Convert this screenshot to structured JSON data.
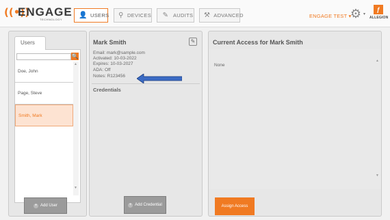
{
  "header": {
    "logo_word": "ENGAGE",
    "logo_sub": "TECHNOLOGY",
    "logo_mark": "((•))",
    "tabs": [
      {
        "label": "USERS",
        "icon": "user-icon",
        "glyph": "👤"
      },
      {
        "label": "DEVICES",
        "icon": "device-icon",
        "glyph": "⚲"
      },
      {
        "label": "AUDITS",
        "icon": "audit-icon",
        "glyph": "✎"
      },
      {
        "label": "ADVANCED",
        "icon": "tools-icon",
        "glyph": "⚒"
      }
    ],
    "org_name": "ENGAGE TEST ▾",
    "gear_glyph": "⚙",
    "gear_caret": "▾",
    "brand": "ALLEGION",
    "brand_mark": "ƒ"
  },
  "users_panel": {
    "tab_label": "Users",
    "search_value": "",
    "search_icon_glyph": "🔍",
    "users": [
      {
        "name": "Doe, John"
      },
      {
        "name": "Page, Steve"
      },
      {
        "name": "Smith, Mark"
      }
    ],
    "scroll_up": "▲",
    "scroll_down": "▼",
    "add_user_label": "Add User",
    "plus_glyph": "+"
  },
  "detail_panel": {
    "title": "Mark Smith",
    "edit_glyph": "✎",
    "email": "Email: mark@sample.com",
    "activated": "Activated: 10-03-2022",
    "expires": "Expires: 10-03-2027",
    "ada": "ADA: Off",
    "notes": "Notes: R123456",
    "credentials_title": "Credentials",
    "add_credential_label": "Add Credential"
  },
  "access_panel": {
    "title": "Current Access for Mark Smith",
    "none_text": "None",
    "assign_label": "Assign Access"
  },
  "colors": {
    "accent": "#f07a22",
    "callout_arrow": "#3b6bc4"
  }
}
